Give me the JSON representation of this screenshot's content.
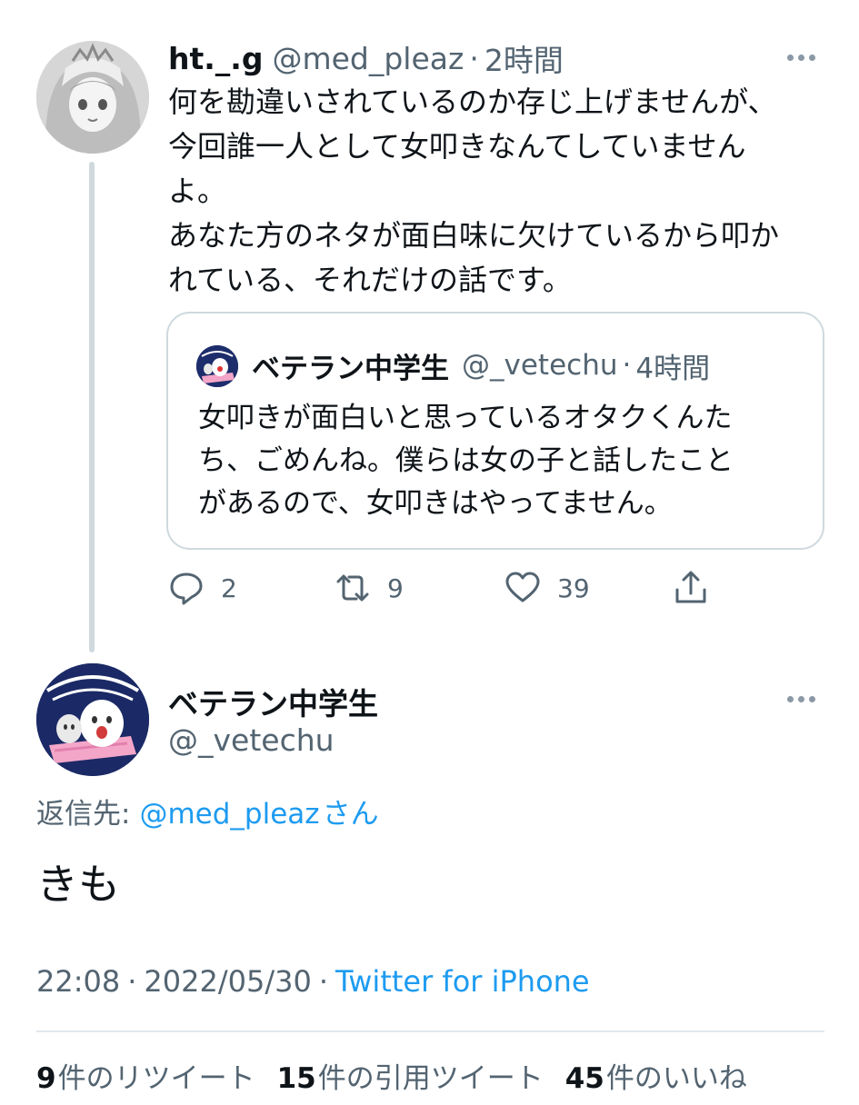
{
  "colors": {
    "text_primary": "#0f1419",
    "text_secondary": "#536471",
    "link": "#1d9bf0",
    "border": "#cfd9de"
  },
  "tweet1": {
    "name": "ht._.g",
    "handle": "@med_pleaz",
    "dot": "·",
    "time": "2時間",
    "body_lines": [
      "何を勘違いされているのか存じ上げませんが、",
      "今回誰一人として女叩きなんてしていません",
      "よ。",
      "あなた方のネタが面白味に欠けているから叩か",
      "れている、それだけの話です。"
    ],
    "quote": {
      "name": "ベテラン中学生",
      "handle": "@_vetechu",
      "dot": "·",
      "time": "4時間",
      "body_lines": [
        "女叩きが面白いと思っているオタクくんた",
        "ち、ごめんね。僕らは女の子と話したこと",
        "があるので、女叩きはやってません。"
      ]
    },
    "actions": {
      "reply_icon": "reply-icon",
      "reply_count": "2",
      "retweet_icon": "retweet-icon",
      "retweet_count": "9",
      "like_icon": "heart-icon",
      "like_count": "39",
      "share_icon": "share-icon"
    }
  },
  "tweet2": {
    "name": "ベテラン中学生",
    "handle": "@_vetechu",
    "reply_to_label": "返信先:",
    "reply_to_handle": "@med_pleaz",
    "reply_to_suffix": "さん",
    "text": "きも",
    "time": "22:08",
    "date": "2022/05/30",
    "sep": "·",
    "source": "Twitter for iPhone",
    "stats": {
      "retweets_count": "9",
      "retweets_label": "件のリツイート",
      "quotes_count": "15",
      "quotes_label": "件の引用ツイート",
      "likes_count": "45",
      "likes_label": "件のいいね"
    }
  }
}
